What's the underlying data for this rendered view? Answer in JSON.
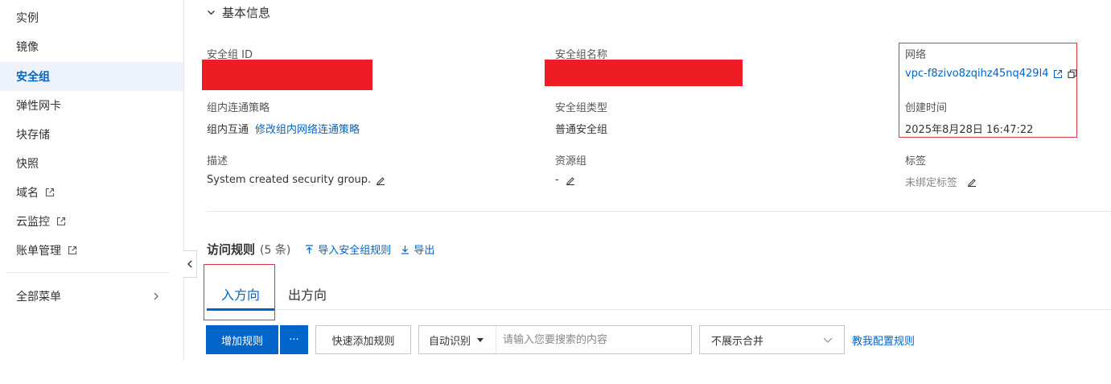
{
  "sidebar": {
    "items": [
      {
        "label": "实例"
      },
      {
        "label": "镜像"
      },
      {
        "label": "安全组"
      },
      {
        "label": "弹性网卡"
      },
      {
        "label": "块存储"
      },
      {
        "label": "快照"
      },
      {
        "label": "域名"
      },
      {
        "label": "云监控"
      },
      {
        "label": "账单管理"
      }
    ],
    "all_menu": "全部菜单"
  },
  "basic_info": {
    "title": "基本信息",
    "sg_id_label": "安全组 ID",
    "sg_name_label": "安全组名称",
    "network_label": "网络",
    "network_value": "vpc-f8zivo8zqihz45nq429l4",
    "policy_label": "组内连通策略",
    "policy_value": "组内互通",
    "policy_link": "修改组内网络连通策略",
    "type_label": "安全组类型",
    "type_value": "普通安全组",
    "created_label": "创建时间",
    "created_value": "2025年8月28日 16:47:22",
    "desc_label": "描述",
    "desc_value": "System created security group.",
    "rg_label": "资源组",
    "rg_value": "-",
    "tags_label": "标签",
    "tags_value": "未绑定标签"
  },
  "rules": {
    "title": "访问规则",
    "count": "(5 条)",
    "import": "导入安全组规则",
    "export": "导出",
    "tabs": [
      {
        "label": "入方向"
      },
      {
        "label": "出方向"
      }
    ],
    "add_rule": "增加规则",
    "more": "···",
    "quick_add": "快速添加规则",
    "search_mode": "自动识别",
    "search_placeholder": "请输入您要搜索的内容",
    "merge_select": "不展示合并",
    "teach": "教我配置规则"
  },
  "colors": {
    "accent": "#0064c8",
    "redaction": "#ee1d25",
    "highlight": "#d9363e"
  }
}
